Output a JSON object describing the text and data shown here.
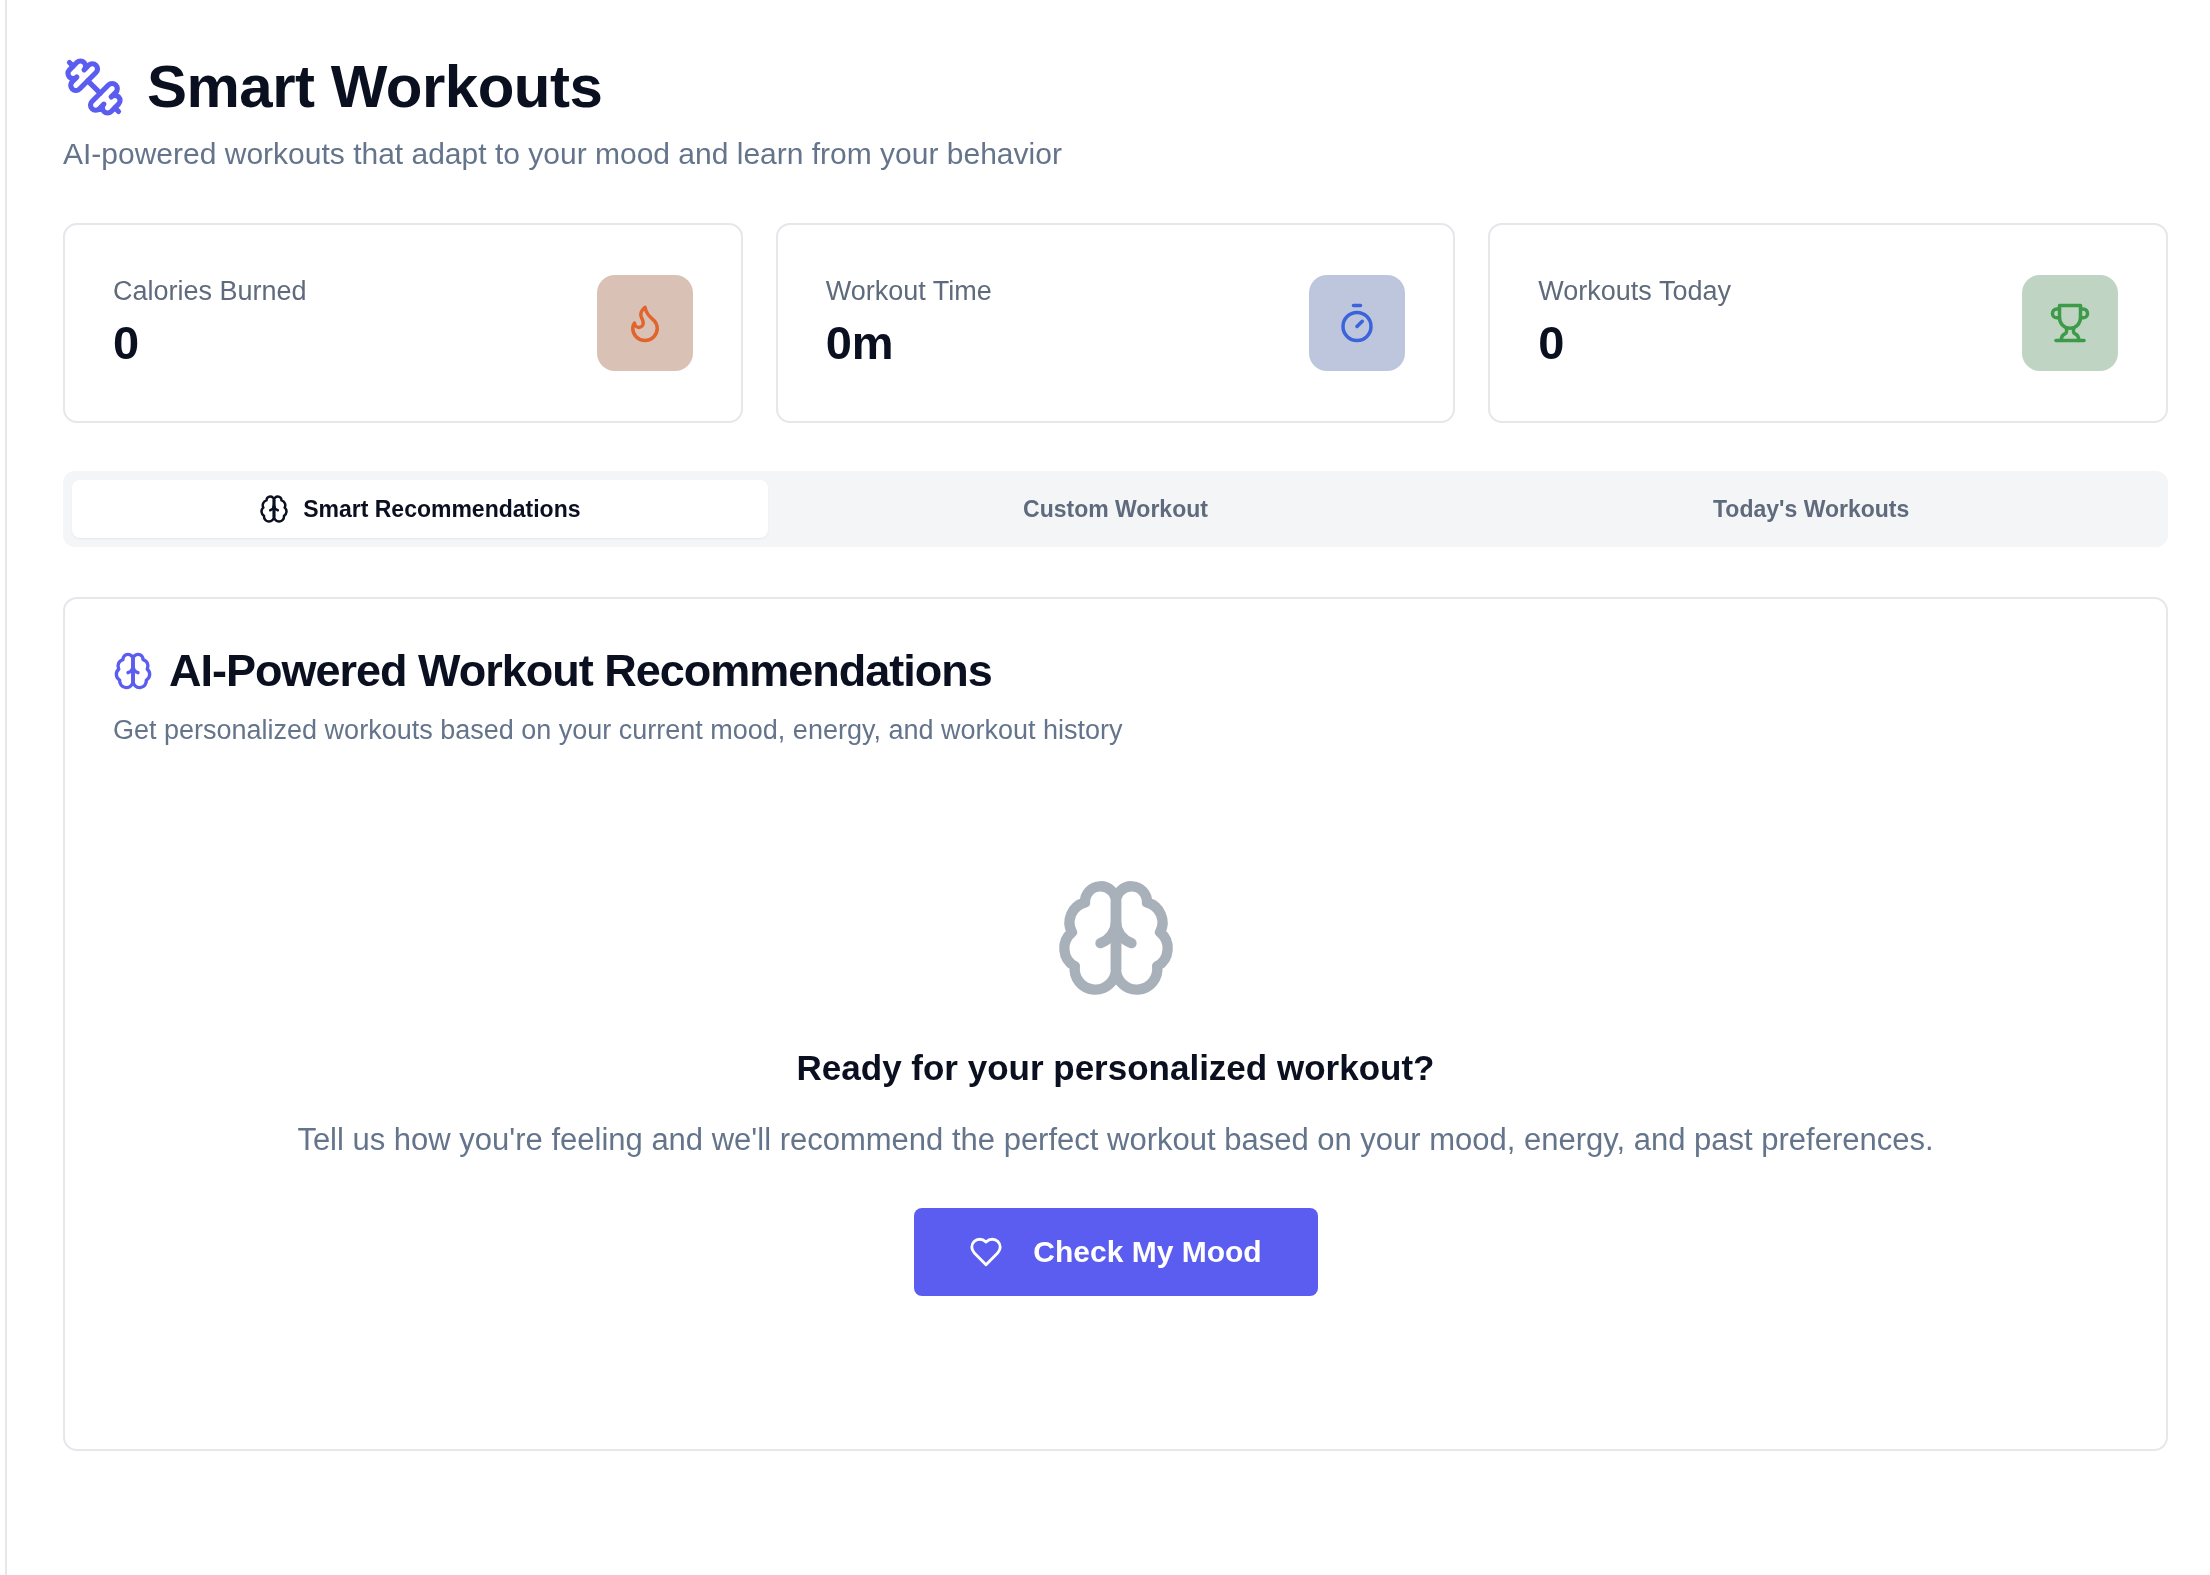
{
  "header": {
    "title": "Smart Workouts",
    "subtitle": "AI-powered workouts that adapt to your mood and learn from your behavior"
  },
  "stats": [
    {
      "label": "Calories Burned",
      "value": "0",
      "kind": "flame"
    },
    {
      "label": "Workout Time",
      "value": "0m",
      "kind": "stopwatch"
    },
    {
      "label": "Workouts Today",
      "value": "0",
      "kind": "trophy"
    }
  ],
  "tabs": [
    {
      "label": "Smart Recommendations",
      "selected": true,
      "kind": "icon"
    },
    {
      "label": "Custom Workout",
      "selected": false,
      "kind": "plain"
    },
    {
      "label": "Today's Workouts",
      "selected": false,
      "kind": "plain"
    }
  ],
  "panel": {
    "title": "AI-Powered Workout Recommendations",
    "description": "Get personalized workouts based on your current mood, energy, and workout history",
    "empty_title": "Ready for your personalized workout?",
    "empty_text": "Tell us how you're feeling and we'll recommend the perfect workout based on your mood, energy, and past preferences.",
    "button": "Check My Mood"
  }
}
